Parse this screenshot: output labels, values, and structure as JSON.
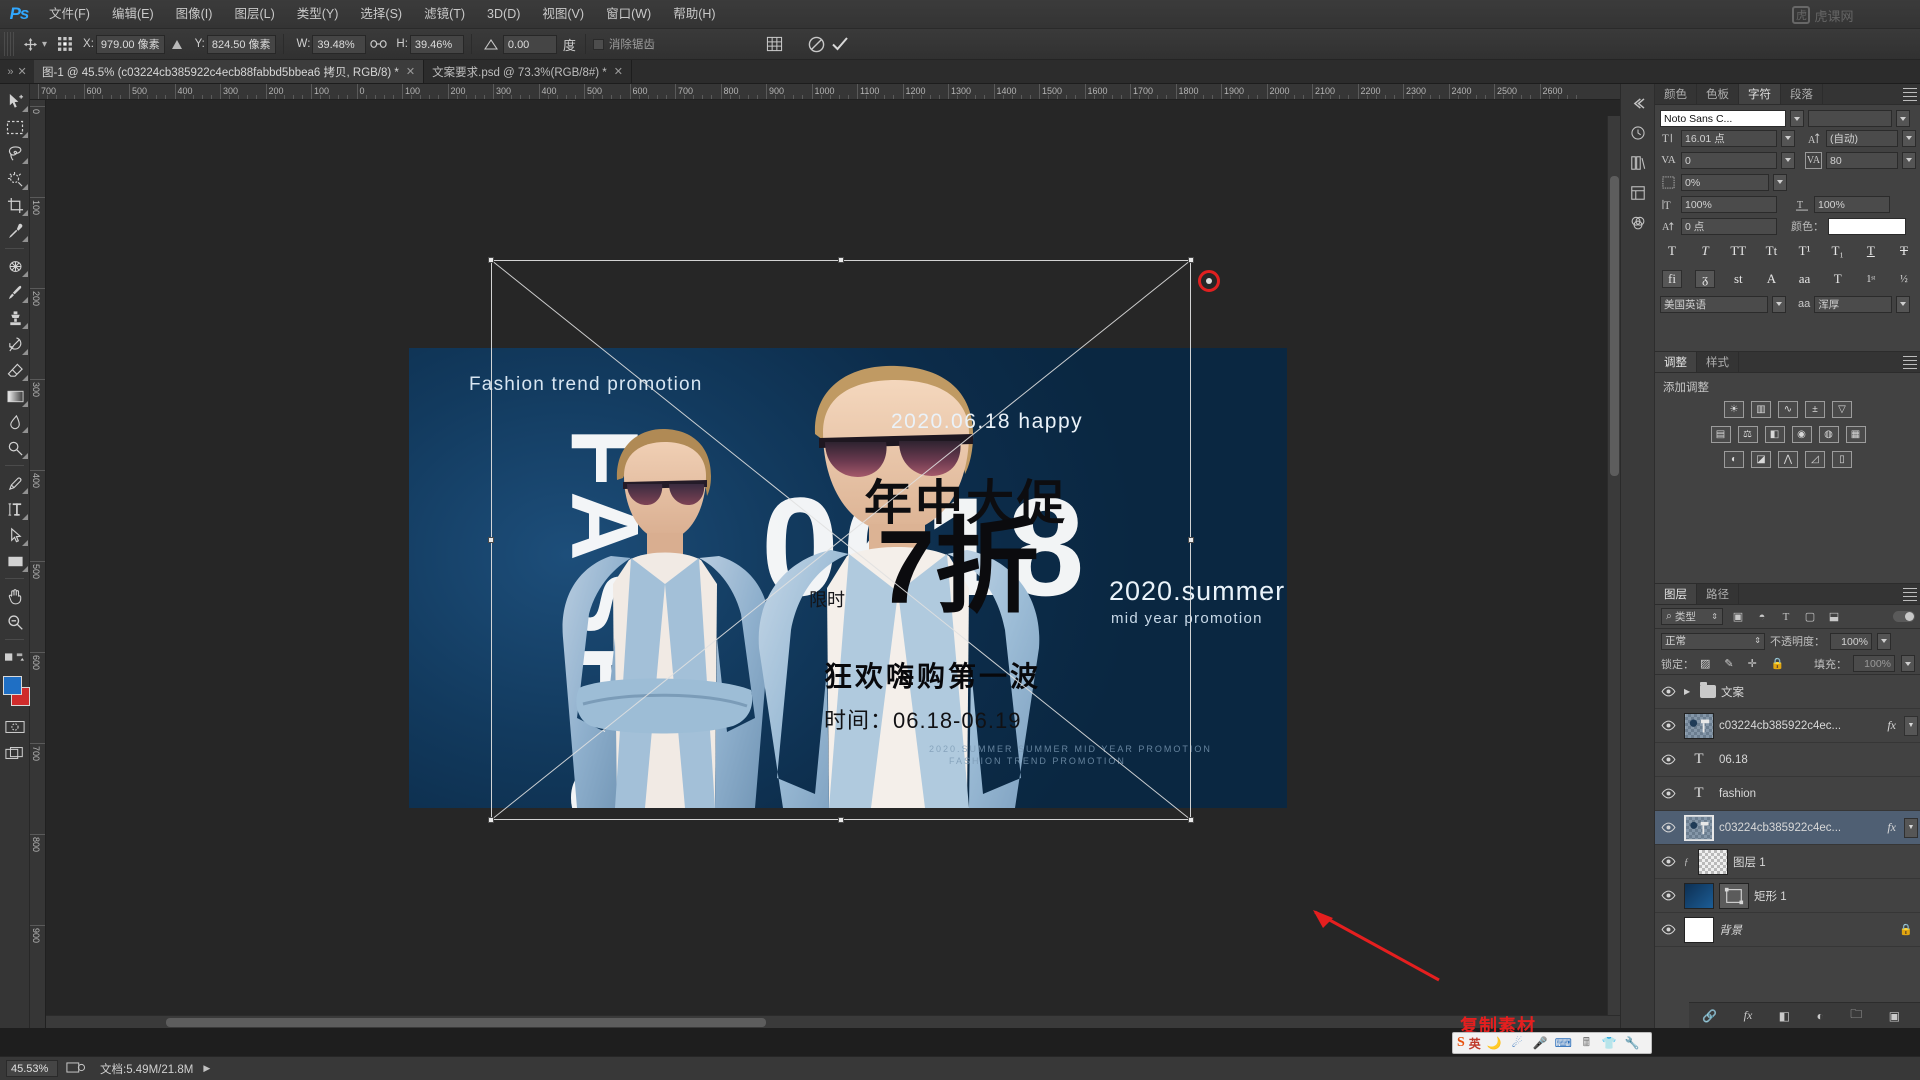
{
  "app": {
    "logo": "Ps",
    "watermark": "虎课网"
  },
  "menubar": {
    "items": [
      {
        "label": "文件(F)"
      },
      {
        "label": "编辑(E)"
      },
      {
        "label": "图像(I)"
      },
      {
        "label": "图层(L)"
      },
      {
        "label": "类型(Y)"
      },
      {
        "label": "选择(S)"
      },
      {
        "label": "滤镜(T)"
      },
      {
        "label": "3D(D)"
      },
      {
        "label": "视图(V)"
      },
      {
        "label": "窗口(W)"
      },
      {
        "label": "帮助(H)"
      }
    ]
  },
  "optionsbar": {
    "x_label": "X:",
    "x_value": "979.00 像素",
    "y_label": "Y:",
    "y_value": "824.50 像素",
    "w_label": "W:",
    "w_value": "39.48%",
    "h_label": "H:",
    "h_value": "39.46%",
    "angle_value": "0.00",
    "angle_unit": "度",
    "antialias_label": "消除锯齿",
    "link_icon": "link-icon",
    "warp_icon": "warp-icon",
    "cancel_icon": "cancel-icon",
    "commit_icon": "commit-icon"
  },
  "tabs": [
    {
      "label": "图-1 @ 45.5% (c03224cb385922c4ecb88fabbd5bbea6 拷贝, RGB/8)",
      "modified": "*",
      "active": true
    },
    {
      "label": "文案要求.psd @ 73.3%(RGB/8#)",
      "modified": "*",
      "active": false
    }
  ],
  "tools": [
    {
      "name": "move-tool"
    },
    {
      "name": "marquee-tool"
    },
    {
      "name": "lasso-tool"
    },
    {
      "name": "quick-selection-tool"
    },
    {
      "name": "crop-tool"
    },
    {
      "name": "eyedropper-tool"
    },
    {
      "name": "spot-healing-tool"
    },
    {
      "name": "brush-tool"
    },
    {
      "name": "clone-stamp-tool"
    },
    {
      "name": "history-brush-tool"
    },
    {
      "name": "eraser-tool"
    },
    {
      "name": "gradient-tool"
    },
    {
      "name": "blur-tool"
    },
    {
      "name": "dodge-tool"
    },
    {
      "name": "pen-tool"
    },
    {
      "name": "type-tool"
    },
    {
      "name": "path-selection-tool"
    },
    {
      "name": "rectangle-tool"
    },
    {
      "name": "hand-tool"
    },
    {
      "name": "zoom-tool"
    }
  ],
  "swatches": {
    "foreground": "#1f6fc4",
    "background": "#cf2b2b"
  },
  "rulers": {
    "top_labels": [
      "700",
      "600",
      "500",
      "400",
      "300",
      "200",
      "100",
      "0",
      "100",
      "200",
      "300",
      "400",
      "500",
      "600",
      "700",
      "800",
      "900",
      "1000",
      "1100",
      "1200",
      "1300",
      "1400",
      "1500",
      "1600",
      "1700",
      "1800",
      "1900",
      "2000",
      "2100",
      "2200",
      "2300",
      "2400",
      "2500",
      "2600"
    ],
    "left_labels": [
      "0",
      "100",
      "200",
      "300",
      "400",
      "500",
      "600",
      "700",
      "800",
      "900"
    ]
  },
  "canvas": {
    "banner": {
      "headline_en": "Fashion trend promotion",
      "happy": "2020.06.18 happy",
      "main_cn": "年中大促",
      "discount": "7折",
      "limited": "限时",
      "summer": "2020.summer",
      "mid_year": "mid year promotion",
      "sub_cn": "狂欢嗨购第一波",
      "time": "时间：06.18-06.19",
      "foot1": "2020.SUMMER  SUMMER  MID YEAR PROMOTION",
      "foot2": "FASHION TREND PROMOTION",
      "word_fashion": "FASHION",
      "word_number": "0618",
      "bg_color": "#123a5e"
    },
    "annotation": {
      "text": "复制素材",
      "color": "#e51f1f"
    }
  },
  "character_panel": {
    "tabs": [
      "颜色",
      "色板",
      "字符",
      "段落"
    ],
    "active_tab": "字符",
    "font_family": "Noto Sans C...",
    "font_style": "",
    "font_size": "16.01 点",
    "leading": "(自动)",
    "tracking_label_left": "VA",
    "kerning": "0",
    "tracking": "80",
    "vertical_scale_label": "T",
    "vertical_scale": "100%",
    "horizontal_scale": "100%",
    "baseline_shift": "0 点",
    "color_label": "颜色：",
    "color_value": "#ffffff",
    "faux_percent": "0%",
    "style_buttons": [
      "T",
      "T",
      "TT",
      "Tt",
      "T¹",
      "T₁",
      "T",
      "T"
    ],
    "ot_buttons": [
      "fi",
      "ᵹ",
      "st",
      "A",
      "aa",
      "T",
      "1ˢᵗ",
      "½"
    ],
    "language": "美国英语",
    "antialias_label": "aa",
    "antialias": "浑厚"
  },
  "adjustments_panel": {
    "tabs": [
      "调整",
      "样式"
    ],
    "active_tab": "调整",
    "title": "添加调整",
    "row1": [
      "brightness-icon",
      "levels-icon",
      "curves-icon",
      "exposure-icon",
      "vibrance-icon"
    ],
    "row2": [
      "huesat-icon",
      "colorbalance-icon",
      "blackwhite-icon",
      "photofilter-icon",
      "channelmixer-icon",
      "colorlookup-icon"
    ],
    "row3": [
      "invert-icon",
      "posterize-icon",
      "threshold-icon",
      "gradientmap-icon",
      "selectivecolor-icon"
    ]
  },
  "layers_panel": {
    "tabs": [
      "图层",
      "路径"
    ],
    "active_tab": "图层",
    "filter_label": "类型",
    "blend_mode": "正常",
    "opacity_label": "不透明度：",
    "opacity_value": "100%",
    "lock_label": "锁定：",
    "fill_label": "填充：",
    "fill_value": "100%",
    "layers": [
      {
        "name": "文案",
        "type": "group",
        "visible": true,
        "selected": false,
        "fx": false,
        "locked": false
      },
      {
        "name": "c03224cb385922c4ec...",
        "type": "smart",
        "visible": true,
        "selected": false,
        "fx": true,
        "locked": false
      },
      {
        "name": "06.18",
        "type": "text",
        "visible": true,
        "selected": false,
        "fx": false,
        "locked": false
      },
      {
        "name": "fashion",
        "type": "text",
        "visible": true,
        "selected": false,
        "fx": false,
        "locked": false
      },
      {
        "name": "c03224cb385922c4ec...",
        "type": "smart",
        "visible": true,
        "selected": true,
        "fx": true,
        "locked": false
      },
      {
        "name": "图层 1",
        "type": "pixel",
        "visible": true,
        "selected": false,
        "fx": false,
        "locked": false
      },
      {
        "name": "矩形 1",
        "type": "shape",
        "visible": true,
        "selected": false,
        "fx": false,
        "locked": false
      },
      {
        "name": "背景",
        "type": "background",
        "visible": true,
        "selected": false,
        "fx": false,
        "locked": true
      }
    ],
    "bottom_icons": [
      "link-layers-icon",
      "add-style-icon",
      "add-mask-icon",
      "new-group-icon",
      "new-layer-icon",
      "delete-layer-icon"
    ]
  },
  "statusbar": {
    "zoom": "45.53%",
    "doc_label": "文档:5.49M/21.8M",
    "arrow_icon": "play-arrow-icon"
  },
  "ime": {
    "logo": "S",
    "mode": "英",
    "icons": [
      "moon-icon",
      "weather-icon",
      "mic-icon",
      "keyboard-icon",
      "calc-icon",
      "skin-icon",
      "tools-icon"
    ]
  }
}
